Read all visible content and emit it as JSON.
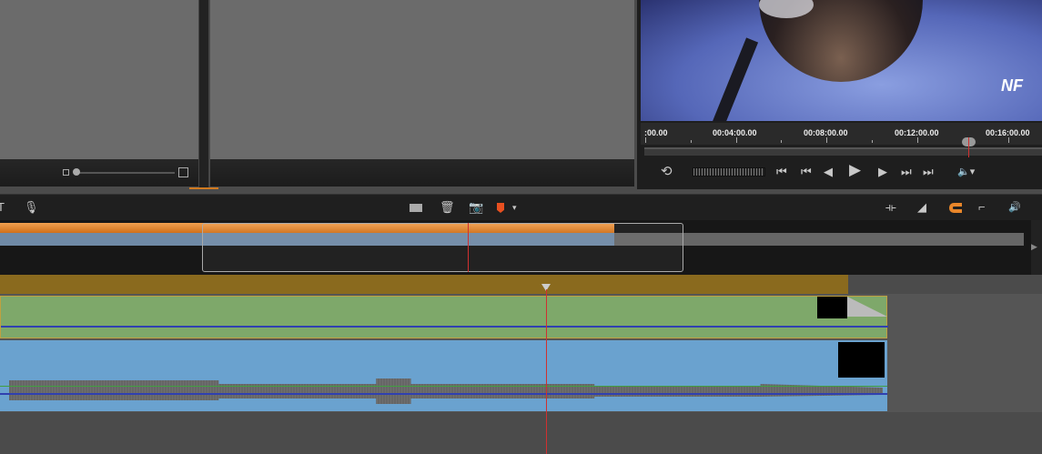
{
  "player": {
    "watermark": "NF",
    "ruler_labels": [
      ":00.00",
      "00:04:00.00",
      "00:08:00.00",
      "00:12:00.00",
      "00:16:00.00"
    ],
    "controls": {
      "loop": "loop-icon",
      "to_start": "⏮",
      "prev_clip": "⏮",
      "prev_frame": "◀",
      "play": "▶",
      "next_frame": "▶",
      "next_clip": "⏭",
      "to_end": "⏭",
      "volume": "🔈▾"
    }
  },
  "toolbar": {
    "left": [
      "T",
      "🎙"
    ],
    "center": [
      "split",
      "🗑",
      "📷",
      "marker ▾"
    ],
    "right": [
      "⟛",
      "◢",
      "⊏",
      "⌐",
      "🔊"
    ]
  },
  "navigator": {
    "progress_percent": 59
  },
  "colors": {
    "accent": "#e8862a",
    "video_clip": "#7ea86a",
    "audio_clip": "#6aa2cf",
    "ruler": "#8a6a1e",
    "playhead": "#d03030"
  }
}
